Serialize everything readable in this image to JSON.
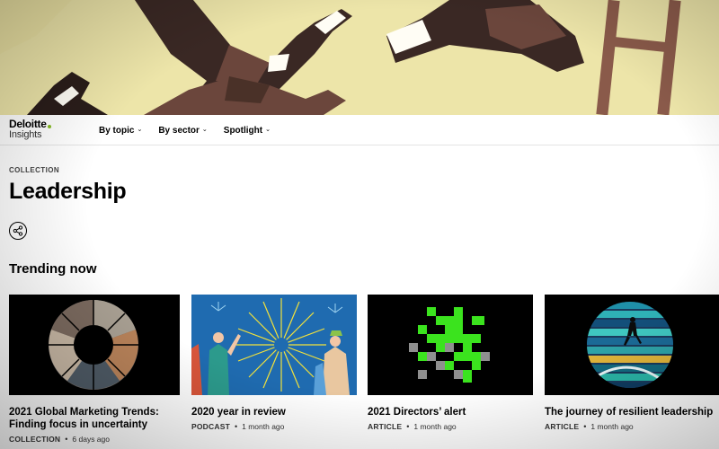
{
  "brand": {
    "logo_top": "Deloitte",
    "logo_bottom": "Insights",
    "accent": "#86bc25"
  },
  "nav": {
    "items": [
      {
        "label": "By topic"
      },
      {
        "label": "By sector"
      },
      {
        "label": "Spotlight"
      }
    ]
  },
  "page": {
    "eyebrow": "COLLECTION",
    "title": "Leadership",
    "share_icon": "share-icon"
  },
  "trending": {
    "heading": "Trending now",
    "cards": [
      {
        "title": "2021 Global Marketing Trends: Finding focus in uncertainty",
        "type": "COLLECTION",
        "time": "6 days ago"
      },
      {
        "title": "2020 year in review",
        "type": "PODCAST",
        "time": "1 month ago"
      },
      {
        "title": "2021 Directors’ alert",
        "type": "ARTICLE",
        "time": "1 month ago"
      },
      {
        "title": "The journey of resilient leadership",
        "type": "ARTICLE",
        "time": "1 month ago"
      }
    ]
  },
  "colors": {
    "hero_bg": "#ece4a8",
    "card3_green": "#3be31e",
    "card2_bg": "#1f6bb0"
  }
}
